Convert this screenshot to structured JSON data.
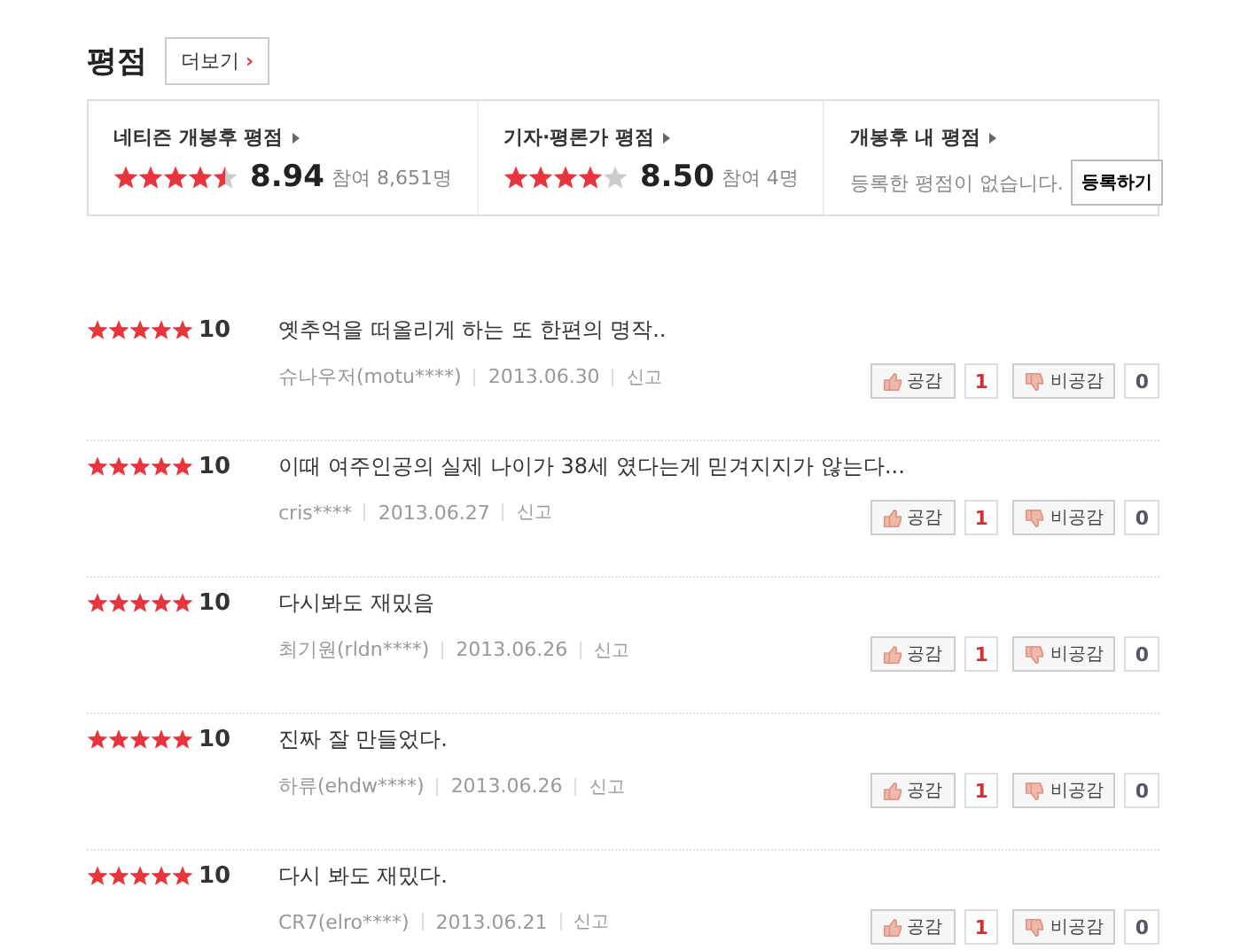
{
  "title": "평점",
  "more_button": {
    "label": "더보기",
    "arrow": "›"
  },
  "summary": [
    {
      "label": "네티즌 개봉후 평점",
      "kind": "score",
      "stars": 4.5,
      "score": "8.94",
      "participants": "참여 8,651명"
    },
    {
      "label": "기자·평론가 평점",
      "kind": "score",
      "stars": 4,
      "score": "8.50",
      "participants": "참여 4명"
    },
    {
      "label": "개봉후 내 평점",
      "kind": "mine",
      "message": "등록한 평점이 없습니다.",
      "button": "등록하기"
    }
  ],
  "reviews": [
    {
      "stars": 5,
      "score": "10",
      "comment": "옛추억을 떠올리게 하는 또 한편의 명작..",
      "user": "슈나우저(motu****)",
      "date": "2013.06.30",
      "report": "신고",
      "like": "공감",
      "like_count": "1",
      "dislike": "비공감",
      "dislike_count": "0"
    },
    {
      "stars": 5,
      "score": "10",
      "comment": "이때 여주인공의 실제 나이가 38세 였다는게 믿겨지지가 않는다...",
      "user": "cris****",
      "date": "2013.06.27",
      "report": "신고",
      "like": "공감",
      "like_count": "1",
      "dislike": "비공감",
      "dislike_count": "0"
    },
    {
      "stars": 5,
      "score": "10",
      "comment": "다시봐도 재밌음",
      "user": "최기원(rldn****)",
      "date": "2013.06.26",
      "report": "신고",
      "like": "공감",
      "like_count": "1",
      "dislike": "비공감",
      "dislike_count": "0"
    },
    {
      "stars": 5,
      "score": "10",
      "comment": "진짜 잘 만들었다.",
      "user": "하류(ehdw****)",
      "date": "2013.06.26",
      "report": "신고",
      "like": "공감",
      "like_count": "1",
      "dislike": "비공감",
      "dislike_count": "0"
    },
    {
      "stars": 5,
      "score": "10",
      "comment": "다시 봐도 재밌다.",
      "user": "CR7(elro****)",
      "date": "2013.06.21",
      "report": "신고",
      "like": "공감",
      "like_count": "1",
      "dislike": "비공감",
      "dislike_count": "0"
    }
  ]
}
